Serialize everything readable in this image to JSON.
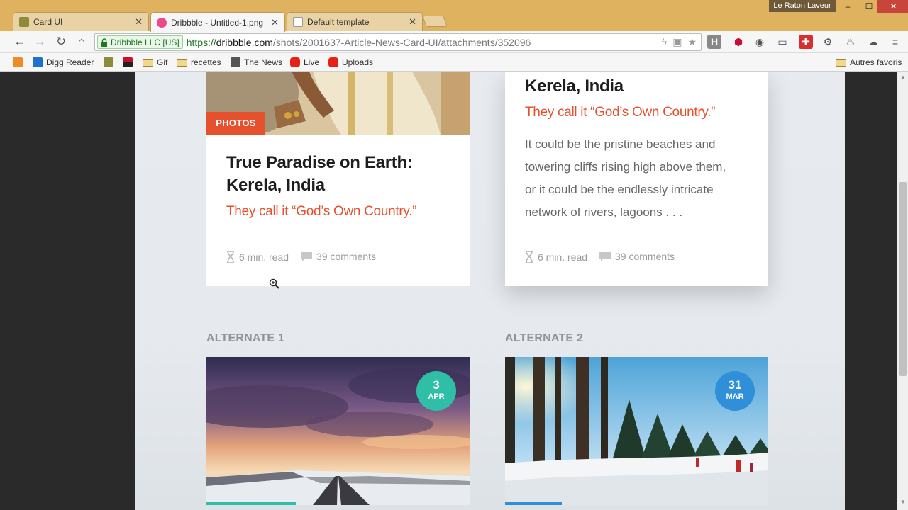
{
  "browser": {
    "tabs": [
      {
        "title": "Card UI",
        "active": false
      },
      {
        "title": "Dribbble - Untitled-1.png",
        "active": true
      },
      {
        "title": "Default template",
        "active": false
      }
    ],
    "profile_name": "Le Raton Laveur",
    "security_label": "Dribbble LLC [US]",
    "url_scheme": "https://",
    "url_host": "dribbble.com",
    "url_path": "/shots/2001637-Article-News-Card-UI/attachments/352096",
    "bookmarks": [
      {
        "label": "Digg Reader"
      },
      {
        "label": "Gif"
      },
      {
        "label": "recettes"
      },
      {
        "label": "The News"
      },
      {
        "label": "Live"
      },
      {
        "label": "Uploads"
      }
    ],
    "other_bookmarks": "Autres favoris",
    "colors": {
      "frame": "#dfb25f",
      "accent": "#e5512d",
      "secure": "#1d7a1d"
    }
  },
  "page": {
    "card_left": {
      "tag": "PHOTOS",
      "title_line1": "True Paradise on Earth:",
      "title_line2": "Kerela, India",
      "subtitle": "They call it “God’s Own Country.”",
      "read_time": "6 min. read",
      "comments": "39 comments"
    },
    "card_right": {
      "title": "Kerela, India",
      "subtitle": "They call it “God’s Own Country.”",
      "body_lines": [
        "It could be the pristine beaches and",
        "towering cliffs rising high above them,",
        "or it could be the endlessly intricate",
        "network of rivers, lagoons . . ."
      ],
      "read_time": "6 min. read",
      "comments": "39 comments"
    },
    "alternate1": {
      "label": "ALTERNATE 1",
      "day": "3",
      "month": "APR",
      "badge_color": "#2fbfa6"
    },
    "alternate2": {
      "label": "ALTERNATE 2",
      "day": "31",
      "month": "MAR",
      "badge_color": "#2f8fd8"
    }
  }
}
